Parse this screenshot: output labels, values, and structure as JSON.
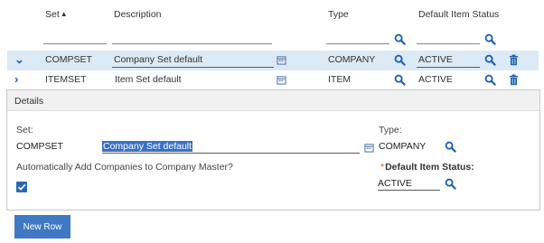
{
  "table": {
    "columns": {
      "set": "Set",
      "description": "Description",
      "type": "Type",
      "default_item_status": "Default Item Status"
    },
    "rows": [
      {
        "set": "COMPSET",
        "description": "Company Set default",
        "type": "COMPANY",
        "status": "ACTIVE",
        "expanded": true
      },
      {
        "set": "ITEMSET",
        "description": "Item Set default",
        "type": "ITEM",
        "status": "ACTIVE",
        "expanded": false
      }
    ]
  },
  "details": {
    "title": "Details",
    "set_label": "Set:",
    "set_value": "COMPSET",
    "description_value": "Company Set default",
    "type_label": "Type:",
    "type_value": "COMPANY",
    "auto_add_label": "Automatically Add Companies to Company Master?",
    "auto_add_checked": true,
    "default_status_label": "Default Item Status:",
    "default_status_value": "ACTIVE"
  },
  "new_row_button": "New Row",
  "colors": {
    "accent": "#3f78c4",
    "selected_row": "#dbeaf5",
    "required": "#c05a1e"
  }
}
